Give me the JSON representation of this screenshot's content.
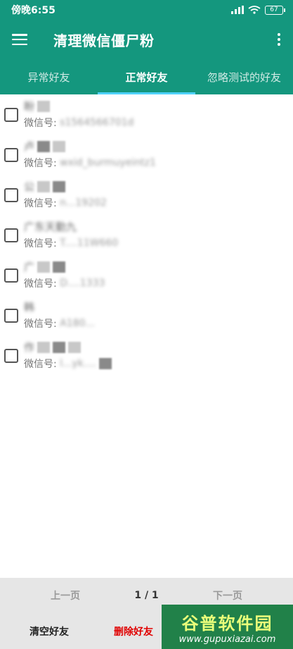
{
  "status": {
    "time": "傍晚6:55",
    "battery": "67"
  },
  "app_bar": {
    "title": "清理微信僵尸粉"
  },
  "tabs": [
    {
      "label": "异常好友",
      "active": false
    },
    {
      "label": "正常好友",
      "active": true
    },
    {
      "label": "忽略测试的好友",
      "active": false
    }
  ],
  "friends": [
    {
      "name": "盼",
      "wx_label": "微信号:",
      "wx_id": "s1564566701d"
    },
    {
      "name": "卢",
      "wx_label": "微信号:",
      "wx_id": "wxid_burmuyeintz1"
    },
    {
      "name": "公",
      "wx_label": "微信号:",
      "wx_id": "n...19202"
    },
    {
      "name": "广东天勤九",
      "wx_label": "微信号:",
      "wx_id": "T....11W660"
    },
    {
      "name": "广",
      "wx_label": "微信号:",
      "wx_id": "D....1333"
    },
    {
      "name": "韩",
      "wx_label": "微信号:",
      "wx_id": "A180..."
    },
    {
      "name": "作",
      "wx_label": "微信号:",
      "wx_id": "l...yk...."
    }
  ],
  "pager": {
    "prev": "上一页",
    "indicator": "1 / 1",
    "next": "下一页"
  },
  "actions": {
    "clear": "清空好友",
    "delete": "删除好友"
  },
  "watermark": {
    "logo": "谷普软件园",
    "url": "www.gupuxiazai.com"
  },
  "colors": {
    "primary": "#14977e",
    "tab_indicator": "#4fd2ff",
    "delete": "#e00000"
  }
}
